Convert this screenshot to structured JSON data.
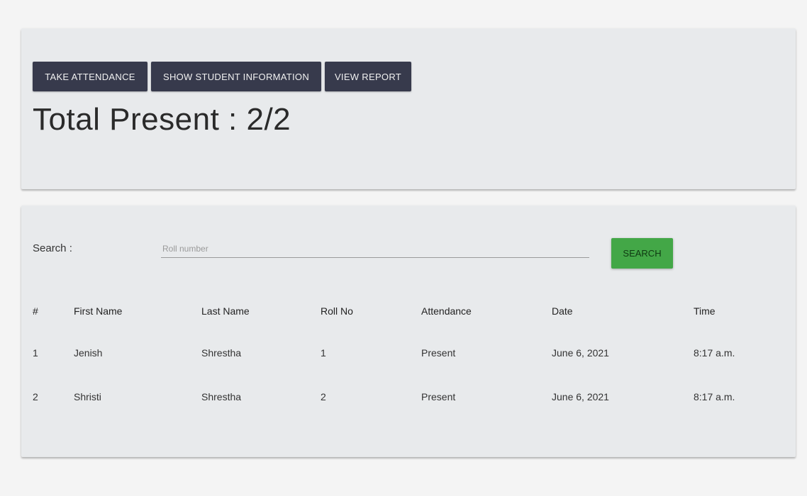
{
  "nav": {
    "take_attendance": "TAKE ATTENDANCE",
    "show_student_information": "SHOW STUDENT INFORMATION",
    "view_report": "VIEW REPORT"
  },
  "summary": {
    "total_present": "Total Present : 2/2"
  },
  "search": {
    "label": "Search :",
    "placeholder": "Roll number",
    "value": "",
    "button_label": "SEARCH"
  },
  "table": {
    "headers": [
      "#",
      "First Name",
      "Last Name",
      "Roll No",
      "Attendance",
      "Date",
      "Time"
    ],
    "rows": [
      [
        "1",
        "Jenish",
        "Shrestha",
        "1",
        "Present",
        "June 6, 2021",
        "8:17 a.m."
      ],
      [
        "2",
        "Shristi",
        "Shrestha",
        "2",
        "Present",
        "June 6, 2021",
        "8:17 a.m."
      ]
    ]
  },
  "colors": {
    "nav_button_bg": "#373a4c",
    "search_button_bg": "#43a747",
    "card_bg": "#e8eaec",
    "page_bg": "#f4f4f4"
  }
}
